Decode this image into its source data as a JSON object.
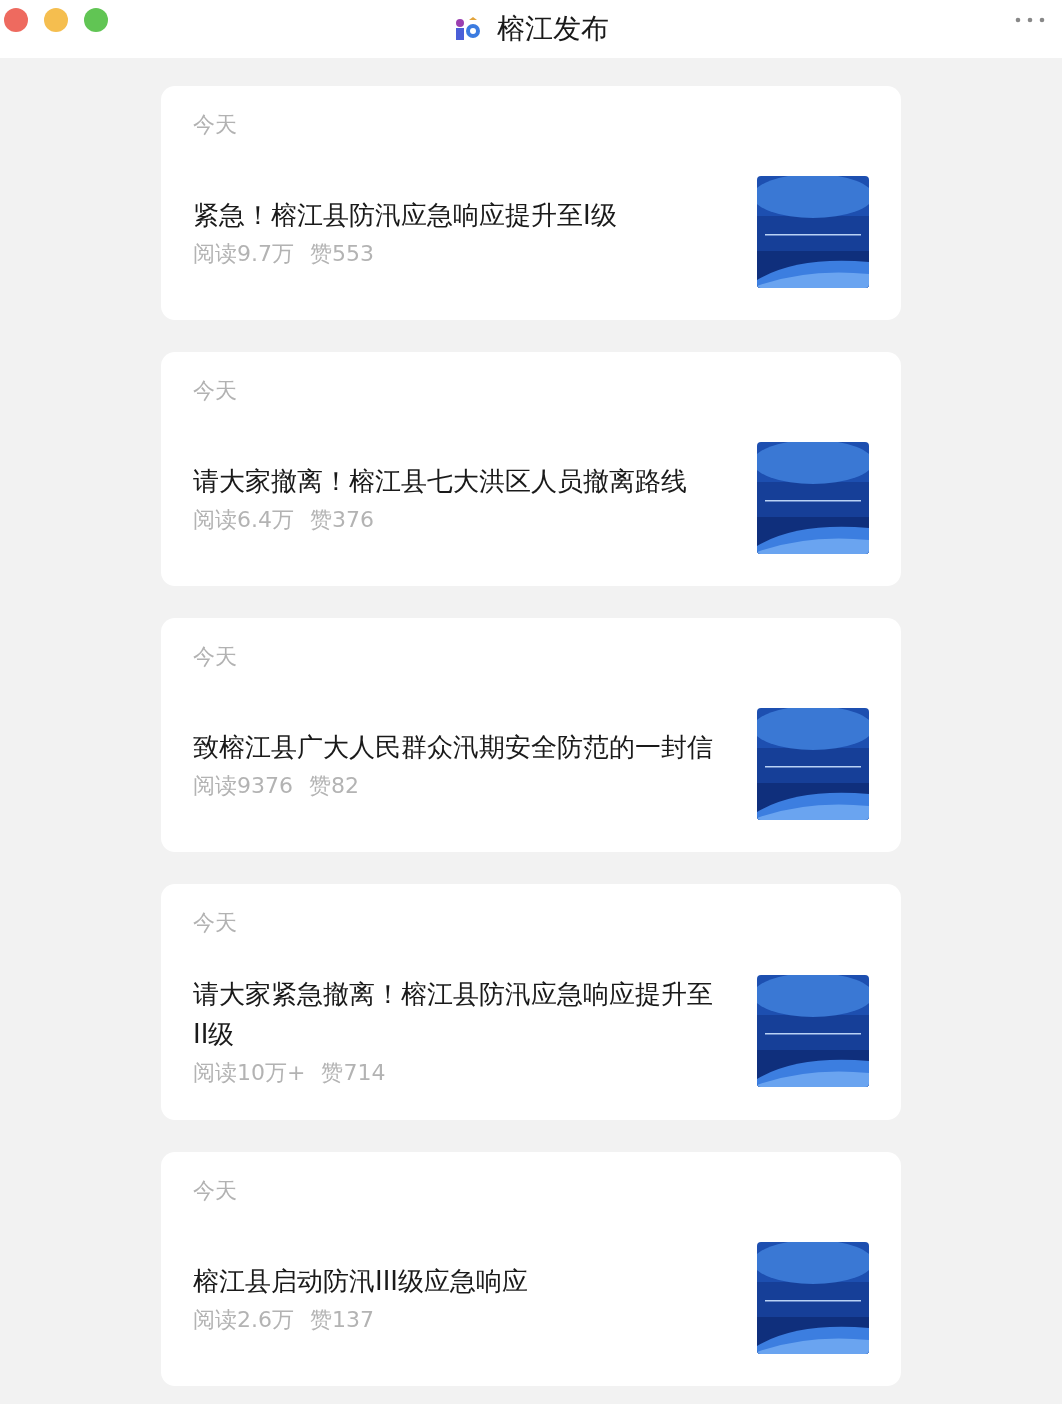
{
  "window": {
    "title": "榕江发布"
  },
  "articles": [
    {
      "date": "今天",
      "title": "紧急！榕江县防汛应急响应提升至I级",
      "reads": "阅读9.7万",
      "likes": "赞553"
    },
    {
      "date": "今天",
      "title": "请大家撤离！榕江县七大洪区人员撤离路线",
      "reads": "阅读6.4万",
      "likes": "赞376"
    },
    {
      "date": "今天",
      "title": "致榕江县广大人民群众汛期安全防范的一封信",
      "reads": "阅读9376",
      "likes": "赞82"
    },
    {
      "date": "今天",
      "title": "请大家紧急撤离！榕江县防汛应急响应提升至II级",
      "reads": "阅读10万+",
      "likes": "赞714"
    },
    {
      "date": "今天",
      "title": "榕江县启动防汛III级应急响应",
      "reads": "阅读2.6万",
      "likes": "赞137"
    }
  ]
}
